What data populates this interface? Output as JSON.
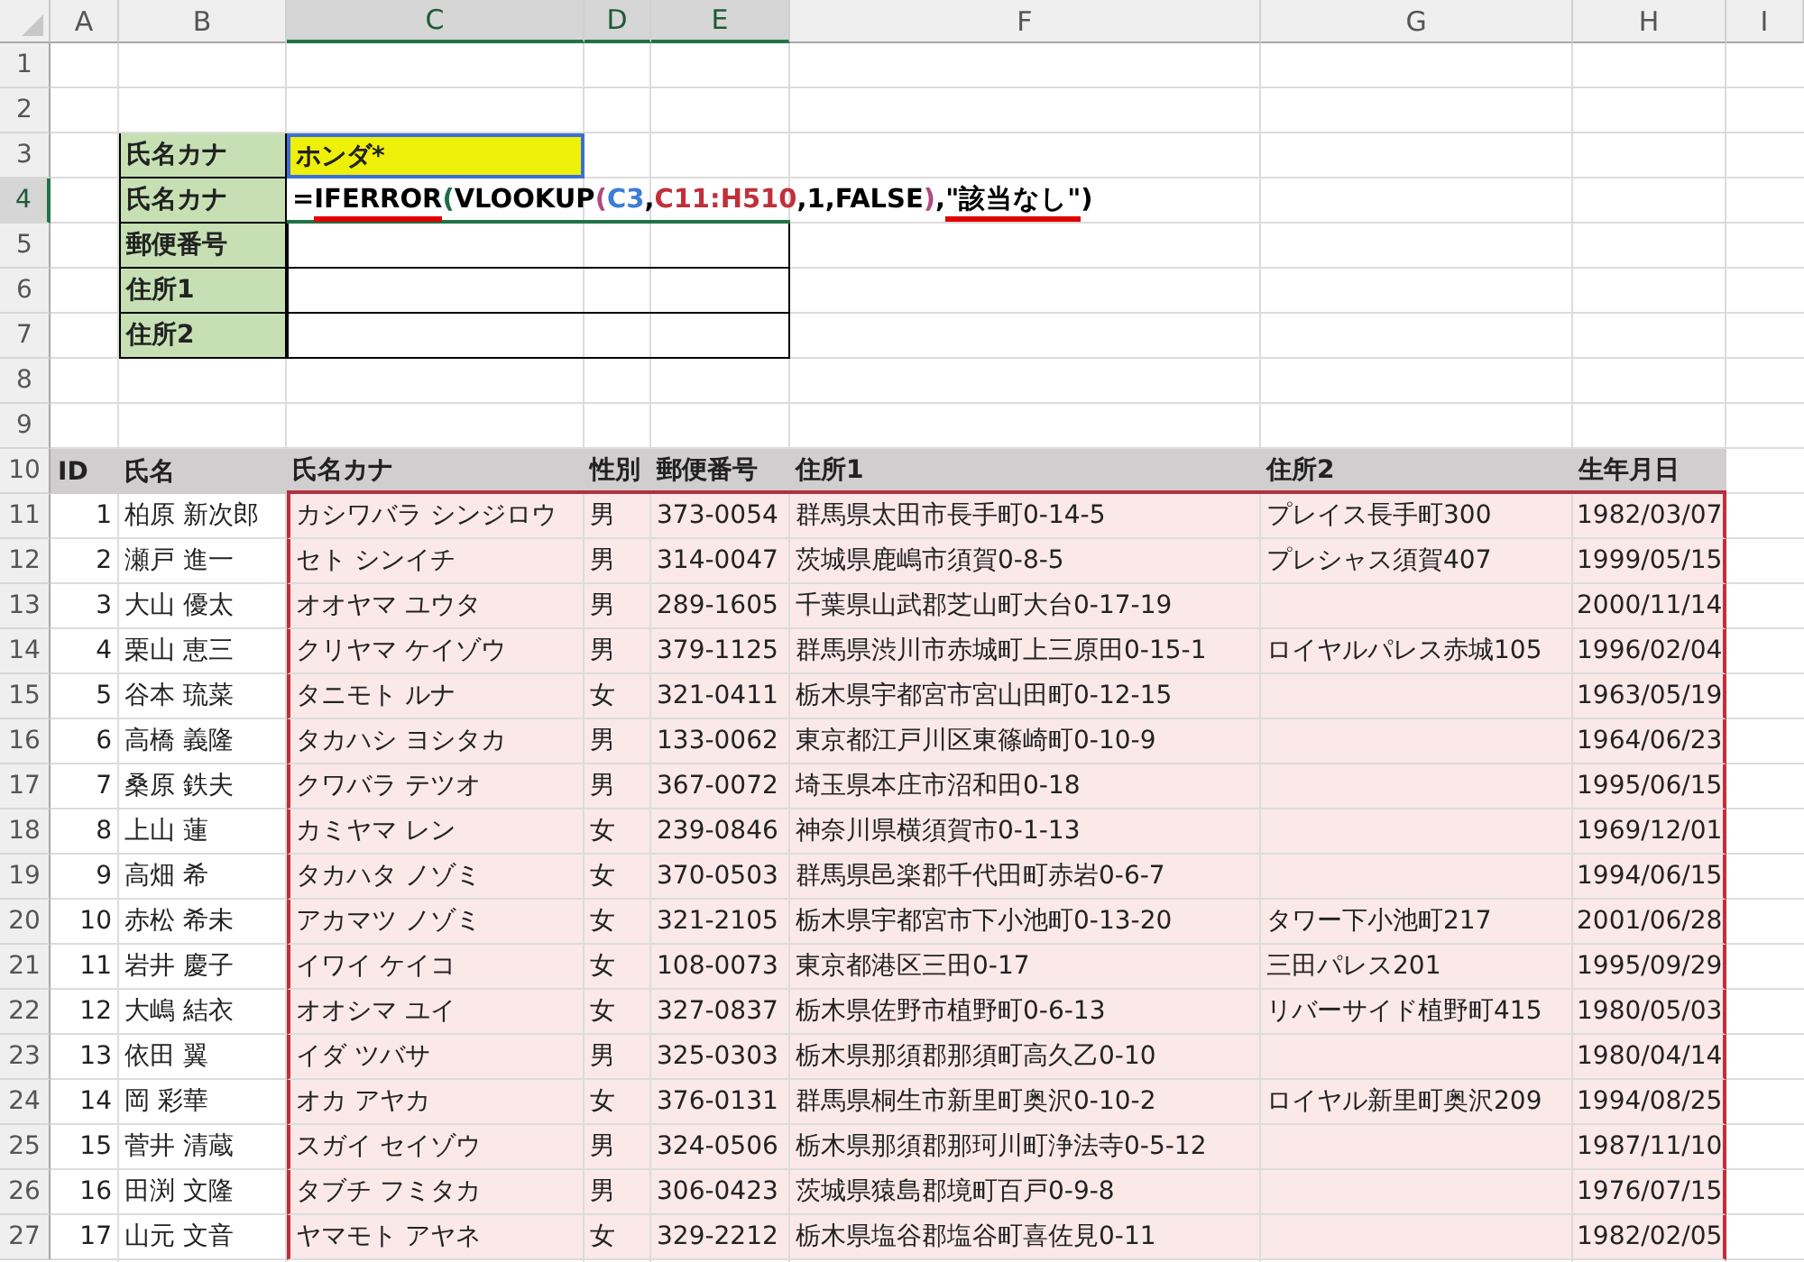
{
  "column_headers": [
    {
      "label": "A",
      "selected": false
    },
    {
      "label": "B",
      "selected": false
    },
    {
      "label": "C",
      "selected": true
    },
    {
      "label": "D",
      "selected": true
    },
    {
      "label": "E",
      "selected": true
    },
    {
      "label": "F",
      "selected": false
    },
    {
      "label": "G",
      "selected": false
    },
    {
      "label": "H",
      "selected": false
    },
    {
      "label": "I",
      "selected": false
    }
  ],
  "row_numbers": [
    {
      "label": "1",
      "selected": false
    },
    {
      "label": "2",
      "selected": false
    },
    {
      "label": "3",
      "selected": false
    },
    {
      "label": "4",
      "selected": true
    },
    {
      "label": "5",
      "selected": false
    },
    {
      "label": "6",
      "selected": false
    },
    {
      "label": "7",
      "selected": false
    },
    {
      "label": "8",
      "selected": false
    },
    {
      "label": "9",
      "selected": false
    },
    {
      "label": "10",
      "selected": false
    },
    {
      "label": "11",
      "selected": false
    },
    {
      "label": "12",
      "selected": false
    },
    {
      "label": "13",
      "selected": false
    },
    {
      "label": "14",
      "selected": false
    },
    {
      "label": "15",
      "selected": false
    },
    {
      "label": "16",
      "selected": false
    },
    {
      "label": "17",
      "selected": false
    },
    {
      "label": "18",
      "selected": false
    },
    {
      "label": "19",
      "selected": false
    },
    {
      "label": "20",
      "selected": false
    },
    {
      "label": "21",
      "selected": false
    },
    {
      "label": "22",
      "selected": false
    },
    {
      "label": "23",
      "selected": false
    },
    {
      "label": "24",
      "selected": false
    },
    {
      "label": "25",
      "selected": false
    },
    {
      "label": "26",
      "selected": false
    },
    {
      "label": "27",
      "selected": false
    }
  ],
  "lookup_form": {
    "rows": [
      {
        "label": "氏名カナ",
        "kind": "input",
        "value": "ホンダ*"
      },
      {
        "label": "氏名カナ",
        "kind": "formula",
        "formula": [
          {
            "text": "=",
            "color": "#000000",
            "underlined": false
          },
          {
            "text": "IFERROR",
            "color": "#000000",
            "underlined": true
          },
          {
            "text": "(",
            "color": "#1f6b45",
            "underlined": false
          },
          {
            "text": "VLOOKUP",
            "color": "#000000",
            "underlined": false
          },
          {
            "text": "(",
            "color": "#b04a80",
            "underlined": false
          },
          {
            "text": "C3",
            "color": "#3b7dd8",
            "underlined": false
          },
          {
            "text": ",",
            "color": "#000000",
            "underlined": false
          },
          {
            "text": "C11:H510",
            "color": "#c0303a",
            "underlined": false
          },
          {
            "text": ",1,FALSE",
            "color": "#000000",
            "underlined": false
          },
          {
            "text": ")",
            "color": "#b04a80",
            "underlined": false
          },
          {
            "text": ",",
            "color": "#000000",
            "underlined": false
          },
          {
            "text": "\"該当なし\"",
            "color": "#000000",
            "underlined": true
          },
          {
            "text": ")",
            "color": "#000000",
            "underlined": false
          }
        ]
      },
      {
        "label": "郵便番号",
        "kind": "empty"
      },
      {
        "label": "住所1",
        "kind": "empty"
      },
      {
        "label": "住所2",
        "kind": "empty"
      }
    ]
  },
  "table": {
    "columns": [
      "ID",
      "氏名",
      "氏名カナ",
      "性別",
      "郵便番号",
      "住所1",
      "住所2",
      "生年月日"
    ],
    "rows": [
      [
        "1",
        "柏原 新次郎",
        "カシワバラ シンジロウ",
        "男",
        "373-0054",
        "群馬県太田市長手町0-14-5",
        "プレイス長手町300",
        "1982/03/07"
      ],
      [
        "2",
        "瀬戸 進一",
        "セト シンイチ",
        "男",
        "314-0047",
        "茨城県鹿嶋市須賀0-8-5",
        "プレシャス須賀407",
        "1999/05/15"
      ],
      [
        "3",
        "大山 優太",
        "オオヤマ ユウタ",
        "男",
        "289-1605",
        "千葉県山武郡芝山町大台0-17-19",
        "",
        "2000/11/14"
      ],
      [
        "4",
        "栗山 恵三",
        "クリヤマ ケイゾウ",
        "男",
        "379-1125",
        "群馬県渋川市赤城町上三原田0-15-1",
        "ロイヤルパレス赤城105",
        "1996/02/04"
      ],
      [
        "5",
        "谷本 琉菜",
        "タニモト ルナ",
        "女",
        "321-0411",
        "栃木県宇都宮市宮山田町0-12-15",
        "",
        "1963/05/19"
      ],
      [
        "6",
        "高橋 義隆",
        "タカハシ ヨシタカ",
        "男",
        "133-0062",
        "東京都江戸川区東篠崎町0-10-9",
        "",
        "1964/06/23"
      ],
      [
        "7",
        "桑原 鉄夫",
        "クワバラ テツオ",
        "男",
        "367-0072",
        "埼玉県本庄市沼和田0-18",
        "",
        "1995/06/15"
      ],
      [
        "8",
        "上山 蓮",
        "カミヤマ レン",
        "女",
        "239-0846",
        "神奈川県横須賀市0-1-13",
        "",
        "1969/12/01"
      ],
      [
        "9",
        "高畑 希",
        "タカハタ ノゾミ",
        "女",
        "370-0503",
        "群馬県邑楽郡千代田町赤岩0-6-7",
        "",
        "1994/06/15"
      ],
      [
        "10",
        "赤松 希未",
        "アカマツ ノゾミ",
        "女",
        "321-2105",
        "栃木県宇都宮市下小池町0-13-20",
        "タワー下小池町217",
        "2001/06/28"
      ],
      [
        "11",
        "岩井 慶子",
        "イワイ ケイコ",
        "女",
        "108-0073",
        "東京都港区三田0-17",
        "三田パレス201",
        "1995/09/29"
      ],
      [
        "12",
        "大嶋 結衣",
        "オオシマ ユイ",
        "女",
        "327-0837",
        "栃木県佐野市植野町0-6-13",
        "リバーサイド植野町415",
        "1980/05/03"
      ],
      [
        "13",
        "依田 翼",
        "イダ ツバサ",
        "男",
        "325-0303",
        "栃木県那須郡那須町高久乙0-10",
        "",
        "1980/04/14"
      ],
      [
        "14",
        "岡 彩華",
        "オカ アヤカ",
        "女",
        "376-0131",
        "群馬県桐生市新里町奥沢0-10-2",
        "ロイヤル新里町奥沢209",
        "1994/08/25"
      ],
      [
        "15",
        "菅井 清蔵",
        "スガイ セイゾウ",
        "男",
        "324-0506",
        "栃木県那須郡那珂川町浄法寺0-5-12",
        "",
        "1987/11/10"
      ],
      [
        "16",
        "田渕 文隆",
        "タブチ フミタカ",
        "男",
        "306-0423",
        "茨城県猿島郡境町百戸0-9-8",
        "",
        "1976/07/15"
      ],
      [
        "17",
        "山元 文音",
        "ヤマモト アヤネ",
        "女",
        "329-2212",
        "栃木県塩谷郡塩谷町喜佐見0-11",
        "",
        "1982/02/05"
      ]
    ]
  }
}
